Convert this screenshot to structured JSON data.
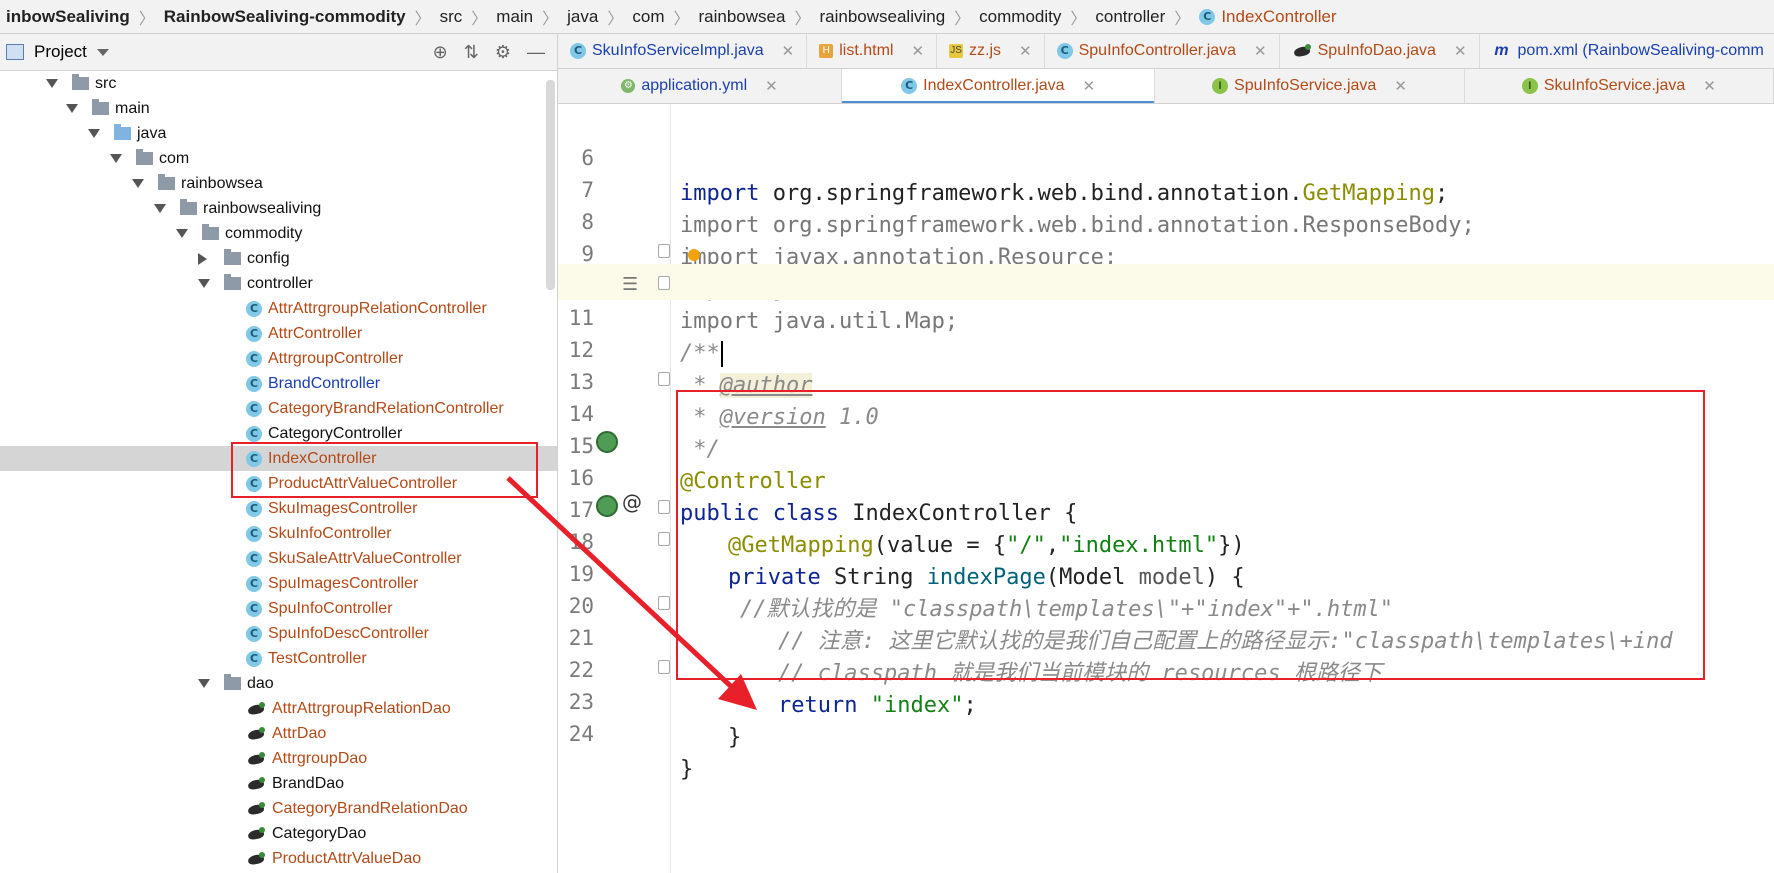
{
  "breadcrumb": [
    "inbowSealiving",
    "RainbowSealiving-commodity",
    "src",
    "main",
    "java",
    "com",
    "rainbowsea",
    "rainbowsealiving",
    "commodity",
    "controller",
    "IndexController"
  ],
  "project": {
    "title": "Project",
    "tree": [
      {
        "label": "src",
        "type": "folder",
        "state": "open"
      },
      {
        "label": "main",
        "type": "folder",
        "state": "open"
      },
      {
        "label": "java",
        "type": "folder-blue",
        "state": "open"
      },
      {
        "label": "com",
        "type": "package",
        "state": "open"
      },
      {
        "label": "rainbowsea",
        "type": "package",
        "state": "open"
      },
      {
        "label": "rainbowsealiving",
        "type": "package",
        "state": "open"
      },
      {
        "label": "commodity",
        "type": "package",
        "state": "open"
      },
      {
        "label": "config",
        "type": "package",
        "state": "closed"
      },
      {
        "label": "controller",
        "type": "package",
        "state": "open"
      },
      {
        "label": "AttrAttrgroupRelationController",
        "type": "class"
      },
      {
        "label": "AttrController",
        "type": "class"
      },
      {
        "label": "AttrgroupController",
        "type": "class"
      },
      {
        "label": "BrandController",
        "type": "class-blue"
      },
      {
        "label": "CategoryBrandRelationController",
        "type": "class"
      },
      {
        "label": "CategoryController",
        "type": "class-dark"
      },
      {
        "label": "IndexController",
        "type": "class",
        "selected": true
      },
      {
        "label": "ProductAttrValueController",
        "type": "class"
      },
      {
        "label": "SkuImagesController",
        "type": "class"
      },
      {
        "label": "SkuInfoController",
        "type": "class"
      },
      {
        "label": "SkuSaleAttrValueController",
        "type": "class"
      },
      {
        "label": "SpuImagesController",
        "type": "class"
      },
      {
        "label": "SpuInfoController",
        "type": "class"
      },
      {
        "label": "SpuInfoDescController",
        "type": "class"
      },
      {
        "label": "TestController",
        "type": "class"
      },
      {
        "label": "dao",
        "type": "package",
        "state": "open"
      },
      {
        "label": "AttrAttrgroupRelationDao",
        "type": "dao"
      },
      {
        "label": "AttrDao",
        "type": "dao"
      },
      {
        "label": "AttrgroupDao",
        "type": "dao"
      },
      {
        "label": "BrandDao",
        "type": "dao-dark"
      },
      {
        "label": "CategoryBrandRelationDao",
        "type": "dao"
      },
      {
        "label": "CategoryDao",
        "type": "dao-dark"
      },
      {
        "label": "ProductAttrValueDao",
        "type": "dao"
      }
    ]
  },
  "tabs_row1": [
    {
      "label": "SkuInfoServiceImpl.java",
      "icon": "C",
      "color": "blue"
    },
    {
      "label": "list.html",
      "icon": "H",
      "color": "red"
    },
    {
      "label": "zz.js",
      "icon": "JS",
      "color": "red"
    },
    {
      "label": "SpuInfoController.java",
      "icon": "C",
      "color": "red"
    },
    {
      "label": "SpuInfoDao.java",
      "icon": "dao",
      "color": "red"
    },
    {
      "label": "pom.xml (RainbowSealiving-comm",
      "icon": "m",
      "color": "blue"
    }
  ],
  "tabs_row2": [
    {
      "label": "application.yml",
      "icon": "yml",
      "color": "blue"
    },
    {
      "label": "IndexController.java",
      "icon": "C",
      "color": "red",
      "active": true
    },
    {
      "label": "SpuInfoService.java",
      "icon": "I",
      "color": "red"
    },
    {
      "label": "SkuInfoService.java",
      "icon": "I",
      "color": "red"
    }
  ],
  "code": {
    "lines": [
      6,
      7,
      8,
      9,
      10,
      11,
      12,
      13,
      14,
      15,
      16,
      17,
      18,
      19,
      20,
      21,
      22,
      23,
      24
    ],
    "l6": {
      "kw": "import",
      "pkg": " org.springframework.web.bind.annotation.",
      "cls": "GetMapping",
      "end": ";"
    },
    "l7": "import org.springframework.web.bind.annotation.ResponseBody;",
    "l8": "import javax.annotation.Resource;",
    "l9": "import java.util.List;",
    "l10": "import java.util.Map;",
    "l11": "/**",
    "l12": {
      "star": " * ",
      "tag": "@author"
    },
    "l13": {
      "star": " * ",
      "tag": "@version",
      "rest": " 1.0"
    },
    "l14": " */",
    "l15": "@Controller",
    "l16": {
      "kw": "public class",
      "rest": " IndexController {"
    },
    "l17": {
      "ann": "@GetMapping",
      "open": "(value = {",
      "s1": "\"/\"",
      "comma": ",",
      "s2": "\"index.html\"",
      "close": "})"
    },
    "l18": {
      "kw": "private",
      "type": " String ",
      "fn": "indexPage",
      "open": "(Model ",
      "param": "model",
      "close": ") {"
    },
    "l19": "//默认找的是 \"classpath\\templates\\\"+\"index\"+\".html\"",
    "l20": "// 注意: 这里它默认找的是我们自己配置上的路径显示:\"classpath\\templates\\+ind",
    "l21": "// classpath 就是我们当前模块的 resources 根路径下",
    "l22": {
      "kw": "return",
      "str": "\"index\"",
      "end": ";"
    },
    "l23": "}",
    "l24": "}"
  },
  "colors": {
    "highlight": "#e8202a",
    "selection": "#d5d5d5",
    "current_line": "#fcfae8"
  }
}
